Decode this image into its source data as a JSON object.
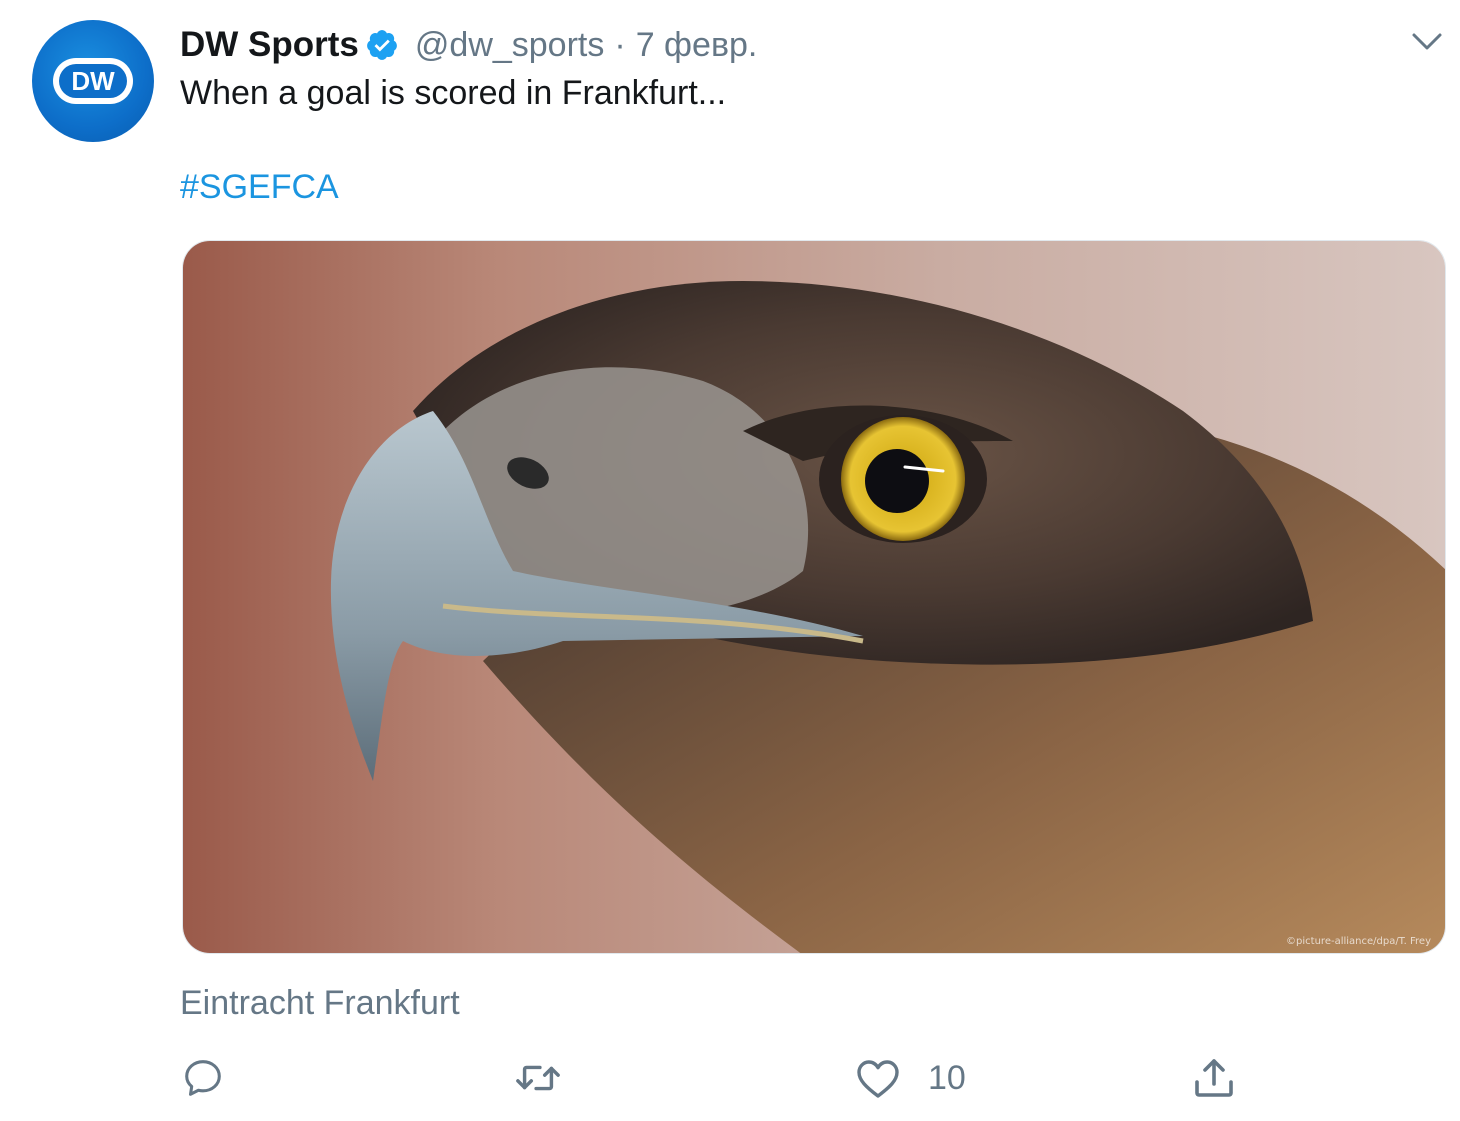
{
  "tweet": {
    "avatar_text": "DW",
    "display_name": "DW Sports",
    "handle": "@dw_sports",
    "separator": "·",
    "date": "7 февр.",
    "text": "When a goal is scored in Frankfurt...",
    "hashtag": "#SGEFCA",
    "media": {
      "description": "Close-up of a golden eagle's head",
      "credit": "©picture-alliance/dpa/T. Frey"
    },
    "topic": "Eintracht Frankfurt",
    "actions": {
      "reply_count": "",
      "retweet_count": "",
      "like_count": "10",
      "share_count": ""
    }
  },
  "colors": {
    "accent": "#1b95e0",
    "muted": "#657786",
    "text": "#14171a",
    "dw_blue": "#0d6ec9"
  },
  "icons": [
    "verified-icon",
    "caret-down-icon",
    "reply-icon",
    "retweet-icon",
    "like-icon",
    "share-icon"
  ]
}
